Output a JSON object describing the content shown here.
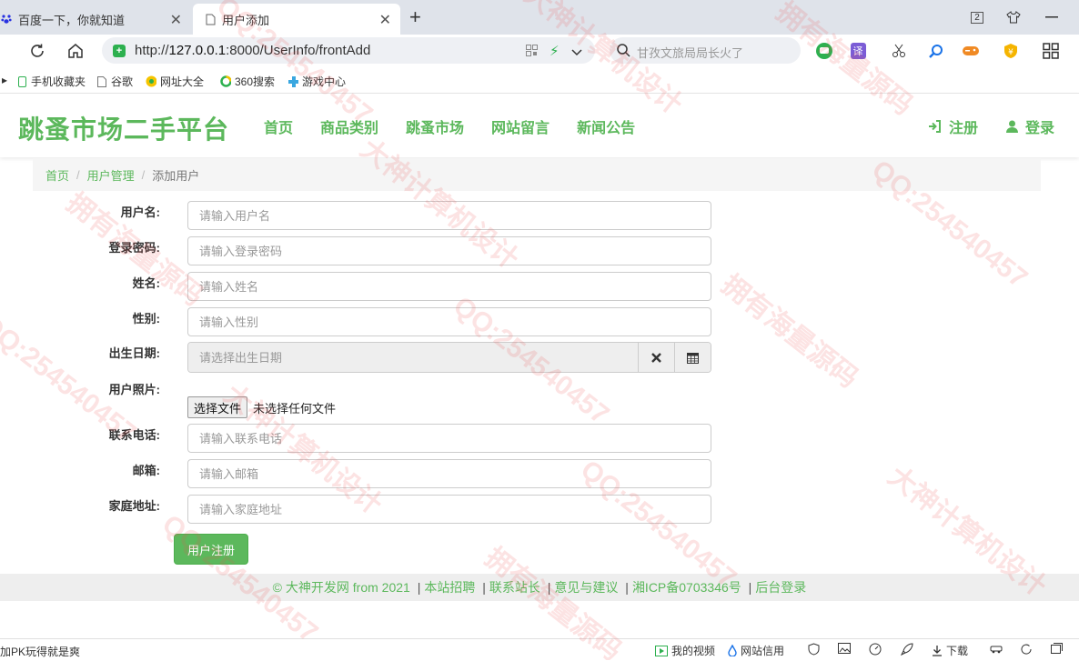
{
  "browser": {
    "tabs": [
      {
        "title": "百度一下，你就知道",
        "active": false
      },
      {
        "title": "用户添加",
        "active": true
      }
    ],
    "tab_count_badge": "2",
    "url": {
      "scheme": "http://",
      "host": "127.0.0.1",
      "rest": ":8000/UserInfo/frontAdd"
    },
    "search_placeholder": "甘孜文旅局局长火了",
    "bookmarks": [
      "手机收藏夹",
      "谷歌",
      "网址大全",
      "360搜索",
      "游戏中心"
    ]
  },
  "site": {
    "brand": "跳蚤市场二手平台",
    "nav": [
      "首页",
      "商品类别",
      "跳蚤市场",
      "网站留言",
      "新闻公告"
    ],
    "register": "注册",
    "login": "登录",
    "accent_color": "#5cb85c"
  },
  "breadcrumb": {
    "home": "首页",
    "section": "用户管理",
    "current": "添加用户"
  },
  "form": {
    "username": {
      "label": "用户名:",
      "placeholder": "请输入用户名"
    },
    "password": {
      "label": "登录密码:",
      "placeholder": "请输入登录密码"
    },
    "name": {
      "label": "姓名:",
      "placeholder": "请输入姓名"
    },
    "gender": {
      "label": "性别:",
      "placeholder": "请输入性别"
    },
    "birthday": {
      "label": "出生日期:",
      "placeholder": "请选择出生日期"
    },
    "photo": {
      "label": "用户照片:",
      "button": "选择文件",
      "status": "未选择任何文件"
    },
    "phone": {
      "label": "联系电话:",
      "placeholder": "请输入联系电话"
    },
    "email": {
      "label": "邮箱:",
      "placeholder": "请输入邮箱"
    },
    "address": {
      "label": "家庭地址:",
      "placeholder": "请输入家庭地址"
    },
    "submit": "用户注册"
  },
  "footer": {
    "copyright": "© 大神开发网 from 2021",
    "links": [
      "本站招聘",
      "联系站长",
      "意见与建议",
      "湘ICP备0703346号",
      "后台登录"
    ]
  },
  "statusbar": {
    "left_text": "加PK玩得就是爽",
    "items": [
      "我的视频",
      "网站信用",
      "下载"
    ]
  },
  "watermark_texts": [
    "QQ:254540457",
    "大神计算机设计",
    "拥有海量源码"
  ]
}
